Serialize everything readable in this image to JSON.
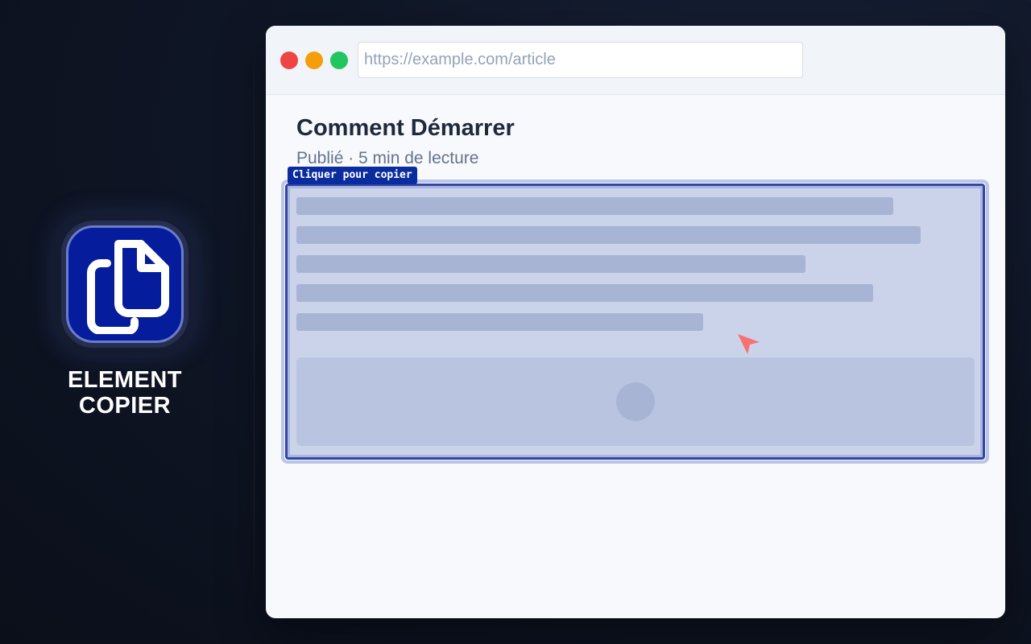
{
  "brand": {
    "name_line1": "ELEMENT",
    "name_line2": "COPIER",
    "icon": "copy-document-icon",
    "colors": {
      "icon_bg": "#051d9c",
      "icon_border": "#6b7cc9"
    }
  },
  "browser": {
    "controls": [
      "close-dot-icon",
      "minimize-dot-icon",
      "maximize-dot-icon"
    ],
    "url_placeholder": "https://example.com/article"
  },
  "article": {
    "title": "Comment Démarrer",
    "meta": "Publié · 5 min de lecture"
  },
  "highlight": {
    "tooltip": "Cliquer pour copier",
    "placeholder_lines": 5,
    "colors": {
      "border": "#3346a8",
      "fill": "#cbd3ea",
      "tag": "#0b2c9f"
    }
  },
  "cursor": {
    "icon": "pointer-cursor-icon",
    "color": "#f87171"
  }
}
